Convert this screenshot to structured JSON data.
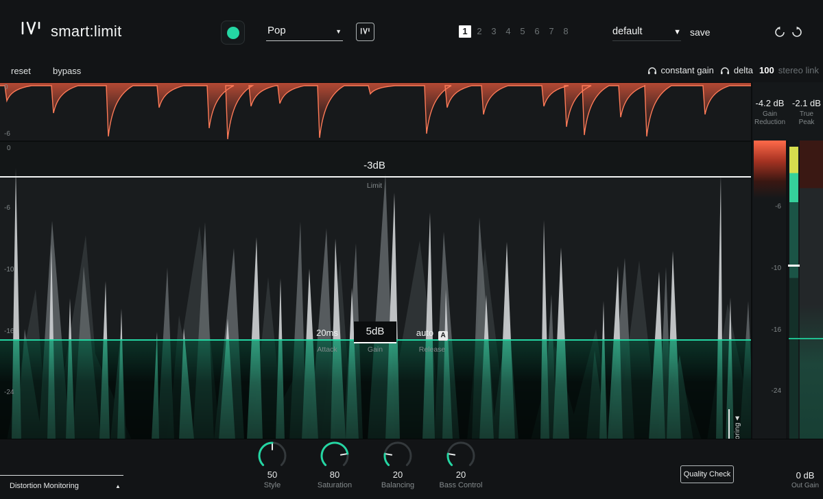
{
  "colors": {
    "accent": "#24d6a3",
    "warn": "#e8593c",
    "light_wave": "#c7cacc",
    "mid_wave": "#5d6365",
    "dark_wave": "#2e3335"
  },
  "header": {
    "title": "smart:limit",
    "genre_value": "Pop",
    "snapshots": [
      "1",
      "2",
      "3",
      "4",
      "5",
      "6",
      "7",
      "8"
    ],
    "preset_value": "default",
    "save_label": "save"
  },
  "toolbar": {
    "reset_label": "reset",
    "bypass_label": "bypass",
    "constant_gain_label": "constant gain",
    "delta_label": "delta",
    "stereo_link_value": "100",
    "stereo_link_label": "stereo link"
  },
  "readouts": {
    "gain_reduction_value": "-4.2 dB",
    "gain_reduction_label_1": "Gain",
    "gain_reduction_label_2": "Reduction",
    "true_peak_value": "-2.1 dB",
    "true_peak_label_1": "True",
    "true_peak_label_2": "Peak"
  },
  "strip_axis": {
    "top": "0",
    "bottom": "-6"
  },
  "wave": {
    "limit_value": "-3dB",
    "limit_label": "Limit",
    "attack_value": "20ms",
    "attack_label": "Attack",
    "gain_value": "5dB",
    "gain_label": "Gain",
    "release_value": "auto",
    "release_auto_badge": "A",
    "release_label": "Release",
    "axis_left": [
      "0",
      "-6",
      "-10",
      "-16",
      "-24"
    ],
    "axis_right": [
      "-6",
      "-10",
      "-16",
      "-24"
    ],
    "loudness_label": "Loudness Monitoring",
    "loudness_arrow": "▲"
  },
  "knobs": [
    {
      "value": "50",
      "label": "Style",
      "pct": 50
    },
    {
      "value": "80",
      "label": "Saturation",
      "pct": 80
    },
    {
      "value": "20",
      "label": "Balancing",
      "pct": 20
    },
    {
      "value": "20",
      "label": "Bass Control",
      "pct": 20
    }
  ],
  "footer": {
    "quality_check_label": "Quality Check",
    "out_gain_value": "0 dB",
    "out_gain_label": "Out Gain",
    "distortion_label": "Distortion Monitoring",
    "distortion_arrow": "▲"
  }
}
